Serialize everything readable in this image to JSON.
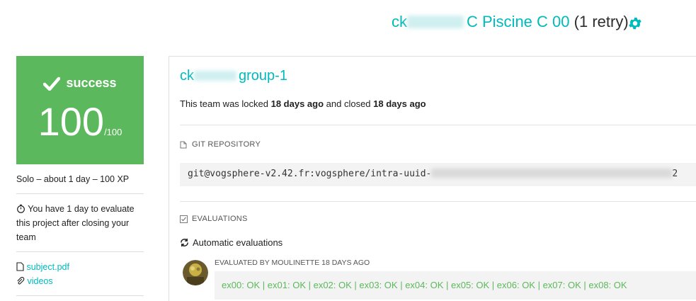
{
  "header": {
    "project_prefix": "ck",
    "project_name": "C Piscine C 00",
    "retry": "(1 retry)"
  },
  "status": {
    "label": "success",
    "score": "100",
    "max": "/100"
  },
  "sidebar": {
    "info": "Solo – about 1 day – 100 XP",
    "eval_notice": "You have 1 day to evaluate this project after closing your team",
    "links": [
      "subject.pdf",
      "videos"
    ]
  },
  "team": {
    "prefix": "ck",
    "group": "group-1",
    "locked_prefix": "This team was locked ",
    "locked_time": "18 days ago",
    "locked_mid": " and closed ",
    "closed_time": "18 days ago"
  },
  "repo": {
    "heading": "GIT REPOSITORY",
    "url_start": "git@vogsphere-v2.42.fr:vogsphere/intra-uuid-",
    "url_end": "2"
  },
  "evaluations": {
    "heading": "EVALUATIONS",
    "automatic": "Automatic evaluations",
    "evaluated_by": "EVALUATED BY MOULINETTE 18 DAYS AGO",
    "result": "ex00: OK | ex01: OK | ex02: OK | ex03: OK | ex04: OK | ex05: OK | ex06: OK | ex07: OK | ex08: OK"
  },
  "colors": {
    "accent": "#00babc",
    "success": "#5cb85c"
  },
  "icons": [
    "gear-icon",
    "checkmark-icon",
    "stopwatch-icon",
    "file-icon",
    "paperclip-icon",
    "repo-icon",
    "checkbox-icon",
    "refresh-icon"
  ]
}
